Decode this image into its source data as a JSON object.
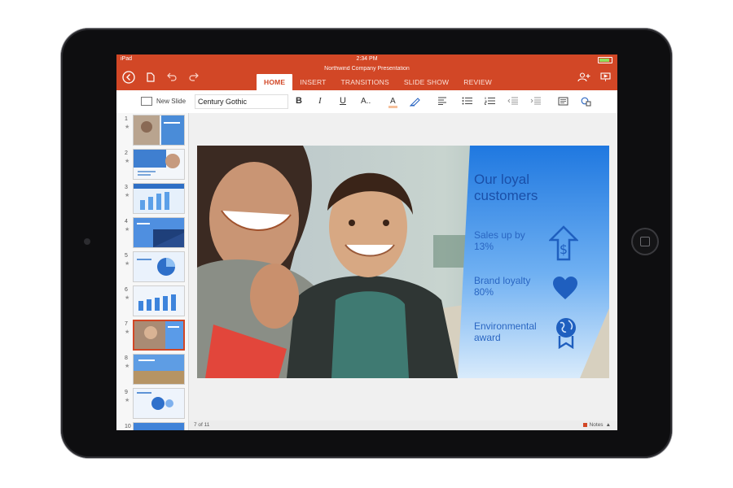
{
  "status": {
    "device": "iPad",
    "time": "2:34 PM"
  },
  "app": {
    "document_title": "Northwind Company Presentation"
  },
  "tabs": [
    {
      "label": "HOME",
      "active": true
    },
    {
      "label": "INSERT",
      "active": false
    },
    {
      "label": "TRANSITIONS",
      "active": false
    },
    {
      "label": "SLIDE SHOW",
      "active": false
    },
    {
      "label": "REVIEW",
      "active": false
    }
  ],
  "ribbon": {
    "new_slide": "New Slide",
    "font_name": "Century Gothic",
    "bold": "B",
    "italic": "I",
    "underline": "U",
    "text_effects": "A..",
    "font_color": "A"
  },
  "thumbnails": [
    {
      "num": "1",
      "star": "★"
    },
    {
      "num": "2",
      "star": "★"
    },
    {
      "num": "3",
      "star": "★"
    },
    {
      "num": "4",
      "star": "★"
    },
    {
      "num": "5",
      "star": "★"
    },
    {
      "num": "6",
      "star": "★"
    },
    {
      "num": "7",
      "star": "★",
      "selected": true
    },
    {
      "num": "8",
      "star": "★"
    },
    {
      "num": "9",
      "star": "★"
    },
    {
      "num": "10",
      "star": ""
    }
  ],
  "slide": {
    "title_line1": "Our loyal",
    "title_line2": "customers",
    "stats": [
      {
        "line1": "Sales up by",
        "line2": "13%",
        "icon": "dollar-arrow-icon"
      },
      {
        "line1": "Brand loyalty",
        "line2": "80%",
        "icon": "heart-icon"
      },
      {
        "line1": "Environmental",
        "line2": "award",
        "icon": "globe-award-icon"
      }
    ]
  },
  "footer": {
    "page": "7 of 11",
    "notes": "Notes"
  },
  "colors": {
    "accent": "#d24726",
    "slide_blue": "#1a4fa8"
  }
}
